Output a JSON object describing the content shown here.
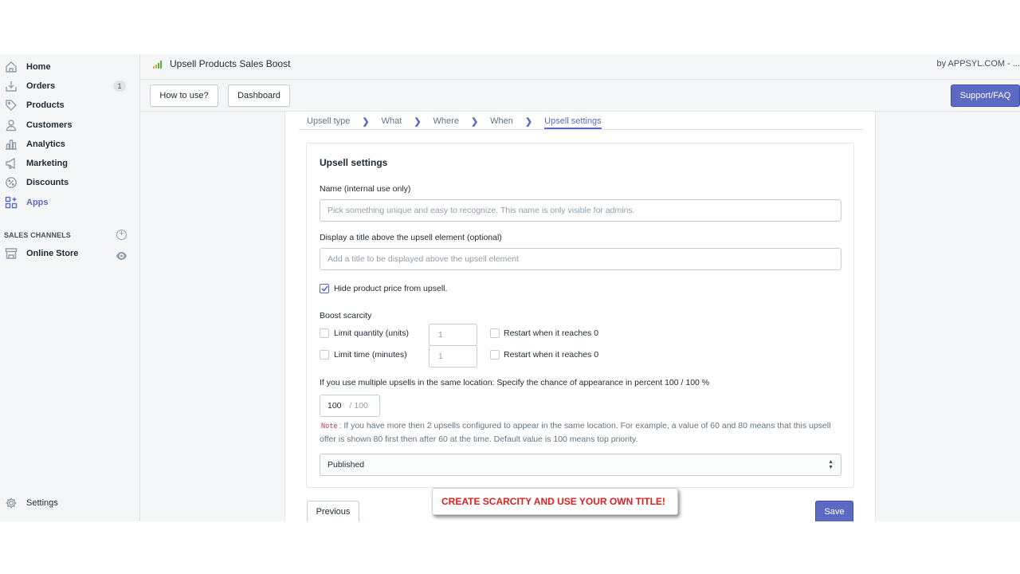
{
  "sidebar": {
    "items": [
      {
        "label": "Home",
        "icon": "home-icon"
      },
      {
        "label": "Orders",
        "icon": "orders-icon",
        "badge": "1"
      },
      {
        "label": "Products",
        "icon": "tag-icon"
      },
      {
        "label": "Customers",
        "icon": "person-icon"
      },
      {
        "label": "Analytics",
        "icon": "bar-chart-icon"
      },
      {
        "label": "Marketing",
        "icon": "megaphone-icon"
      },
      {
        "label": "Discounts",
        "icon": "discount-icon"
      },
      {
        "label": "Apps",
        "icon": "apps-icon",
        "active": true
      }
    ],
    "sales_channels_title": "SALES CHANNELS",
    "online_store": "Online Store",
    "settings": "Settings"
  },
  "header": {
    "app_title": "Upsell Products Sales Boost",
    "by": "by APPSYL.COM - ..."
  },
  "toolbar": {
    "how_to_use": "How to use?",
    "dashboard": "Dashboard",
    "support": "Support/FAQ"
  },
  "steps": [
    "Upsell type",
    "What",
    "Where",
    "When",
    "Upsell settings"
  ],
  "form": {
    "card_title": "Upsell settings",
    "name_label": "Name (internal use only)",
    "name_placeholder": "Pick something unique and easy to recognize. This name is only visible for admins.",
    "title_label": "Display a title above the upsell element (optional)",
    "title_placeholder": "Add a title to be displayed above the upsell element",
    "hide_price_label": "Hide product price from upsell.",
    "hide_price_checked": true,
    "boost_scarcity_label": "Boost scarcity",
    "limit_quantity_label": "Limit quantity (units)",
    "limit_quantity_value": "1",
    "limit_time_label": "Limit time (minutes)",
    "limit_time_value": "1",
    "restart_label": "Restart when it reaches 0",
    "chance_label": "If you use multiple upsells in the same location: Specify the chance of appearance in percent 100 / 100 %",
    "chance_value": "100",
    "chance_max": "/ 100",
    "note_tag": "Note",
    "note_text": ": If you have more then 2 upsells configured to appear in the same location. For example, a value of 60 and 80 means that this upsell offer is shown 80 first then after 60 at the time. Default value is 100 means top priority.",
    "status_value": "Published",
    "previous": "Previous",
    "save": "Save"
  },
  "banner": "CREATE SCARCITY AND USE YOUR OWN TITLE!",
  "colors": {
    "accent": "#5c6ac4",
    "banner_text": "#e02020"
  }
}
